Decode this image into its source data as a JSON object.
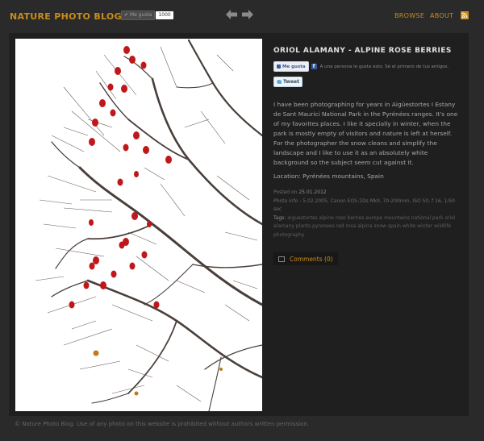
{
  "header": {
    "site_title": "NATURE PHOTO BLOG",
    "like_mini_label": "Me gusta",
    "like_mini_count": "1000",
    "nav": {
      "browse": "BROWSE",
      "about": "ABOUT"
    }
  },
  "post": {
    "title": "ORIOL ALAMANY - ALPINE ROSE BERRIES",
    "fb_like_label": "Me gusta",
    "fb_like_text": "A una persona le gusta esto. Sé el primero de tus amigos.",
    "tweet_label": "Tweet",
    "description": "I have been photographing for years in Aigüestortes I Estany de Sant Maurici National Park in the Pyrénées ranges. It's one of my favorites places. I like it specially in winter, when the park is mostly empty of visitors and nature is left at herself. For the photographer the snow cleans and simplify the landscape and I like to use it as an absolutely white background so the subject seem cut against it.",
    "location": "Location: Pyrénées mountains, Spain",
    "posted_prefix": "Posted on ",
    "posted_date": "25.01.2012",
    "photo_info": "Photo info - 5.02.2005, Canon EOS-1Ds MkII, 70-200mm, ISO 50, f 16, 1/50 sec",
    "tags_label": "Tags: ",
    "tags": "aiguestortes alpine rose berries europe mountains national park oriol alamany plants pyrenees red rosa alpina snow spain white winter wildlife photography",
    "comments_label": "Comments (0)"
  },
  "footer": {
    "text": "© Nature Photo Blog. Use of any photo on this website is prohibited without authors written permission."
  },
  "colors": {
    "accent": "#c98d1e",
    "page_bg": "#2a2a2a",
    "panel_bg": "#1f1f1f",
    "berry": "#c0171a"
  },
  "icons": {
    "prev": "arrow-left-icon",
    "next": "arrow-right-icon",
    "rss": "rss-icon",
    "comments": "comment-icon"
  }
}
